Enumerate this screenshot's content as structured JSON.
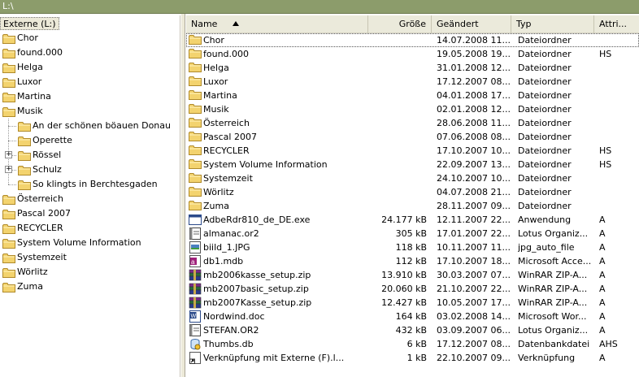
{
  "window": {
    "title": "L:\\"
  },
  "tree": {
    "root_label": "Externe (L:)",
    "items": [
      {
        "label": "Chor"
      },
      {
        "label": "found.000"
      },
      {
        "label": "Helga"
      },
      {
        "label": "Luxor"
      },
      {
        "label": "Martina"
      },
      {
        "label": "Musik"
      },
      {
        "label": "An der schönen böauen Donau"
      },
      {
        "label": "Operette"
      },
      {
        "label": "Rössel"
      },
      {
        "label": "Schulz"
      },
      {
        "label": "So klingts in Berchtesgaden"
      },
      {
        "label": "Österreich"
      },
      {
        "label": "Pascal 2007"
      },
      {
        "label": "RECYCLER"
      },
      {
        "label": "System Volume Information"
      },
      {
        "label": "Systemzeit"
      },
      {
        "label": "Wörlitz"
      },
      {
        "label": "Zuma"
      }
    ]
  },
  "list": {
    "columns": {
      "name": "Name",
      "size": "Größe",
      "modified": "Geändert",
      "type": "Typ",
      "attributes": "Attri..."
    },
    "rows": [
      {
        "name": "Chor",
        "size": "",
        "modified": "14.07.2008 11...",
        "type": "Dateiordner",
        "attr": "",
        "icon": "folder-icon"
      },
      {
        "name": "found.000",
        "size": "",
        "modified": "19.05.2008 19...",
        "type": "Dateiordner",
        "attr": "HS",
        "icon": "folder-icon"
      },
      {
        "name": "Helga",
        "size": "",
        "modified": "31.01.2008 12...",
        "type": "Dateiordner",
        "attr": "",
        "icon": "folder-icon"
      },
      {
        "name": "Luxor",
        "size": "",
        "modified": "17.12.2007 08...",
        "type": "Dateiordner",
        "attr": "",
        "icon": "folder-icon"
      },
      {
        "name": "Martina",
        "size": "",
        "modified": "04.01.2008 17...",
        "type": "Dateiordner",
        "attr": "",
        "icon": "folder-icon"
      },
      {
        "name": "Musik",
        "size": "",
        "modified": "02.01.2008 12...",
        "type": "Dateiordner",
        "attr": "",
        "icon": "folder-icon"
      },
      {
        "name": "Österreich",
        "size": "",
        "modified": "28.06.2008 11...",
        "type": "Dateiordner",
        "attr": "",
        "icon": "folder-icon"
      },
      {
        "name": "Pascal 2007",
        "size": "",
        "modified": "07.06.2008 08...",
        "type": "Dateiordner",
        "attr": "",
        "icon": "folder-icon"
      },
      {
        "name": "RECYCLER",
        "size": "",
        "modified": "17.10.2007 10...",
        "type": "Dateiordner",
        "attr": "HS",
        "icon": "folder-icon"
      },
      {
        "name": "System Volume Information",
        "size": "",
        "modified": "22.09.2007 13...",
        "type": "Dateiordner",
        "attr": "HS",
        "icon": "folder-icon"
      },
      {
        "name": "Systemzeit",
        "size": "",
        "modified": "24.10.2007 10...",
        "type": "Dateiordner",
        "attr": "",
        "icon": "folder-icon"
      },
      {
        "name": "Wörlitz",
        "size": "",
        "modified": "04.07.2008 21...",
        "type": "Dateiordner",
        "attr": "",
        "icon": "folder-icon"
      },
      {
        "name": "Zuma",
        "size": "",
        "modified": "28.11.2007 09...",
        "type": "Dateiordner",
        "attr": "",
        "icon": "folder-icon"
      },
      {
        "name": "AdbeRdr810_de_DE.exe",
        "size": "24.177 kB",
        "modified": "12.11.2007 22...",
        "type": "Anwendung",
        "attr": "A",
        "icon": "exe-icon"
      },
      {
        "name": "almanac.or2",
        "size": "305 kB",
        "modified": "17.01.2007 22...",
        "type": "Lotus Organiz...",
        "attr": "A",
        "icon": "organizer-icon"
      },
      {
        "name": "biild_1.JPG",
        "size": "118 kB",
        "modified": "10.11.2007 11...",
        "type": "jpg_auto_file",
        "attr": "A",
        "icon": "image-icon"
      },
      {
        "name": "db1.mdb",
        "size": "112 kB",
        "modified": "17.10.2007 18...",
        "type": "Microsoft Acce...",
        "attr": "A",
        "icon": "access-icon"
      },
      {
        "name": "mb2006kasse_setup.zip",
        "size": "13.910 kB",
        "modified": "30.03.2007 07...",
        "type": "WinRAR ZIP-A...",
        "attr": "A",
        "icon": "zip-icon"
      },
      {
        "name": "mb2007basic_setup.zip",
        "size": "20.060 kB",
        "modified": "21.10.2007 22...",
        "type": "WinRAR ZIP-A...",
        "attr": "A",
        "icon": "zip-icon"
      },
      {
        "name": "mb2007Kasse_setup.zip",
        "size": "12.427 kB",
        "modified": "10.05.2007 17...",
        "type": "WinRAR ZIP-A...",
        "attr": "A",
        "icon": "zip-icon"
      },
      {
        "name": "Nordwind.doc",
        "size": "164 kB",
        "modified": "03.02.2008 14...",
        "type": "Microsoft Wor...",
        "attr": "A",
        "icon": "word-icon"
      },
      {
        "name": "STEFAN.OR2",
        "size": "432 kB",
        "modified": "03.09.2007 06...",
        "type": "Lotus Organiz...",
        "attr": "A",
        "icon": "organizer-icon"
      },
      {
        "name": "Thumbs.db",
        "size": "6 kB",
        "modified": "17.12.2007 08...",
        "type": "Datenbankdatei",
        "attr": "AHS",
        "icon": "db-icon"
      },
      {
        "name": "Verknüpfung mit Externe (F).l...",
        "size": "1 kB",
        "modified": "22.10.2007 09...",
        "type": "Verknüpfung",
        "attr": "A",
        "icon": "shortcut-icon"
      }
    ]
  },
  "colors": {
    "titlebar": "#8c9c6b",
    "folder": "#f3d36e",
    "header": "#ebeadb"
  }
}
